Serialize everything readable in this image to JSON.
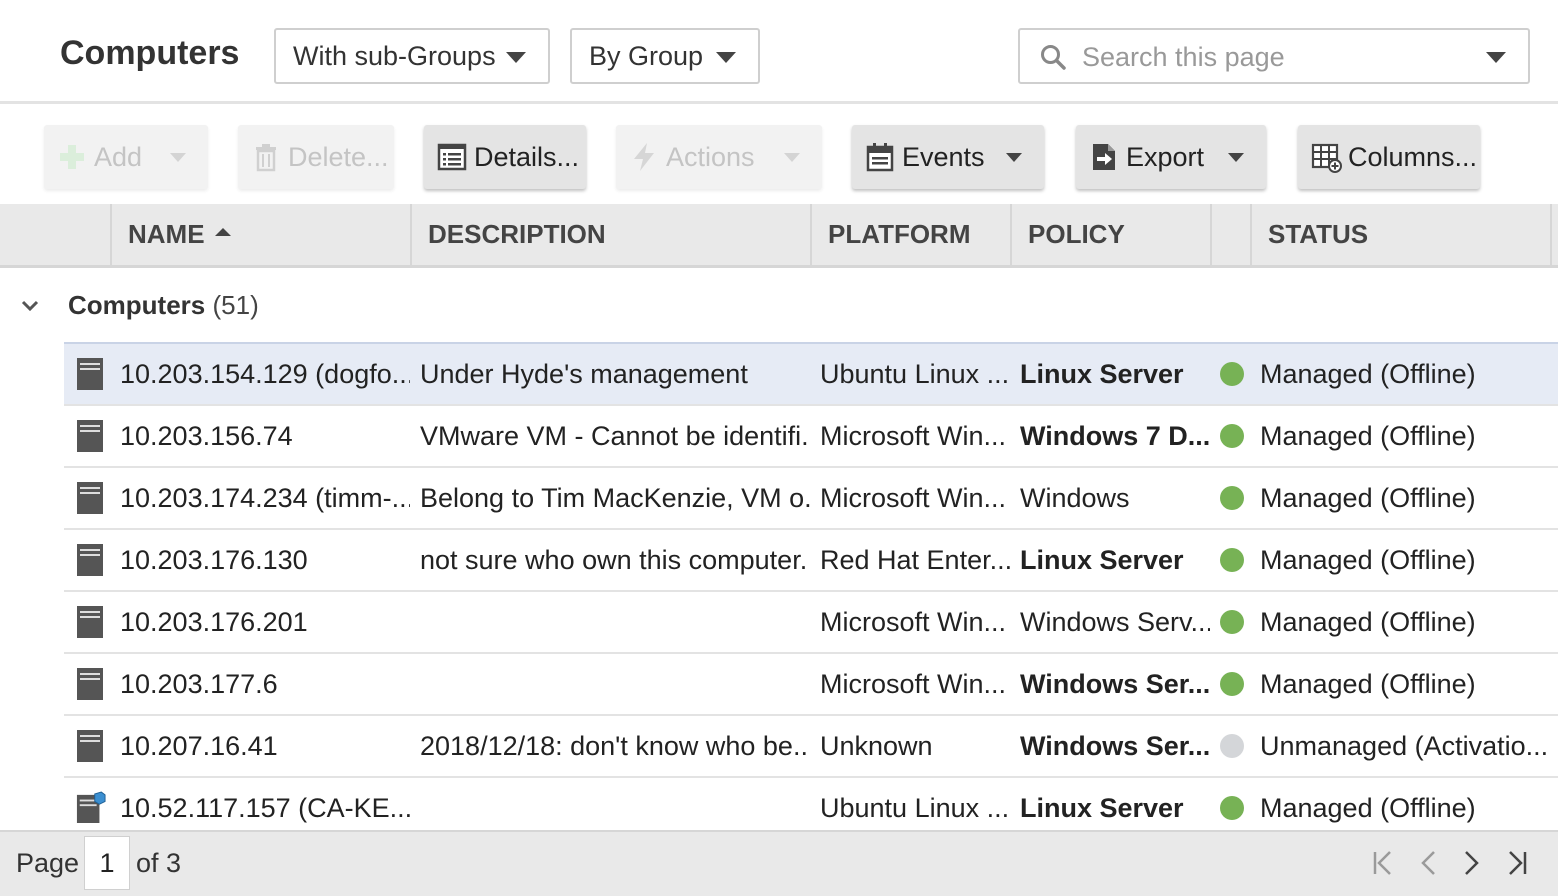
{
  "header": {
    "title": "Computers",
    "scope_dropdown": "With sub-Groups",
    "grouping_dropdown": "By Group",
    "search_placeholder": "Search this page"
  },
  "toolbar": {
    "add": "Add",
    "delete": "Delete...",
    "details": "Details...",
    "actions": "Actions",
    "events": "Events",
    "export": "Export",
    "columns": "Columns..."
  },
  "columns": {
    "name": "NAME",
    "description": "DESCRIPTION",
    "platform": "PLATFORM",
    "policy": "POLICY",
    "status": "STATUS"
  },
  "group": {
    "name": "Computers",
    "count": "(51)"
  },
  "rows": [
    {
      "name": "10.203.154.129 (dogfo...",
      "description": "Under Hyde's management",
      "platform": "Ubuntu Linux ...",
      "policy": "Linux Server",
      "status": "Managed (Offline)"
    },
    {
      "name": "10.203.156.74",
      "description": "VMware VM - Cannot be identifi...",
      "platform": "Microsoft Win...",
      "policy": "Windows 7 D...",
      "status": "Managed (Offline)"
    },
    {
      "name": "10.203.174.234 (timm-...",
      "description": "Belong to Tim MacKenzie, VM o...",
      "platform": "Microsoft Win...",
      "policy": "Windows",
      "status": "Managed (Offline)"
    },
    {
      "name": "10.203.176.130",
      "description": "not sure who own this computer.",
      "platform": "Red Hat Enter...",
      "policy": "Linux Server",
      "status": "Managed (Offline)"
    },
    {
      "name": "10.203.176.201",
      "description": "",
      "platform": "Microsoft Win...",
      "policy": "Windows Serv...",
      "status": "Managed (Offline)"
    },
    {
      "name": "10.203.177.6",
      "description": "",
      "platform": "Microsoft Win...",
      "policy": "Windows Ser...",
      "status": "Managed (Offline)"
    },
    {
      "name": "10.207.16.41",
      "description": "2018/12/18: don't know who be...",
      "platform": "Unknown",
      "policy": "Windows Ser...",
      "status": "Unmanaged (Activatio..."
    },
    {
      "name": "10.52.117.157 (CA-KE...",
      "description": "",
      "platform": "Ubuntu Linux ...",
      "policy": "Linux Server",
      "status": "Managed (Offline)"
    }
  ],
  "row_icons": [
    "server-icon",
    "server-icon",
    "server-icon",
    "server-icon",
    "server-icon",
    "server-icon",
    "server-icon",
    "virtual-machine-icon"
  ],
  "policy_bold": [
    true,
    true,
    false,
    true,
    false,
    true,
    true,
    true
  ],
  "status_colors": {
    "managed": "#77b255",
    "unmanaged": "#d4d6d9"
  },
  "footer": {
    "page_label": "Page",
    "page_value": "1",
    "of_label": "of 3"
  }
}
